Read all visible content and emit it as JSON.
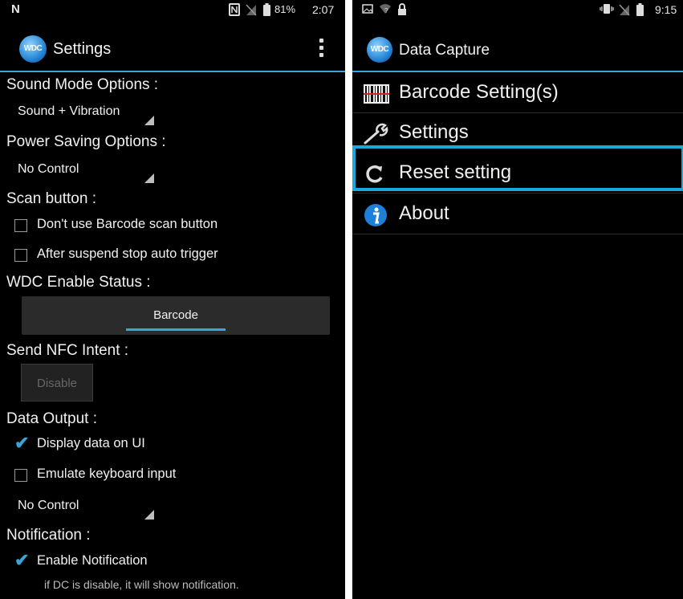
{
  "left_phone": {
    "status": {
      "battery_pct": "81%",
      "time": "2:07"
    },
    "title": "Settings",
    "logo_text": "WDC",
    "sections": {
      "sound_mode": "Sound Mode Options :",
      "power_saving": "Power Saving Options :",
      "scan_button": "Scan button :",
      "wdc_enable": "WDC Enable Status :",
      "send_nfc": "Send NFC Intent :",
      "data_output": "Data Output :",
      "notification": "Notification :"
    },
    "spinners": {
      "sound_mode": "Sound + Vibration",
      "power_saving": "No Control",
      "data_output": "No Control"
    },
    "checkboxes": [
      {
        "label": "Don't use Barcode scan button",
        "checked": false
      },
      {
        "label": "After suspend stop auto trigger",
        "checked": false
      },
      {
        "label": "Display data on UI",
        "checked": true
      },
      {
        "label": "Emulate keyboard input",
        "checked": false
      },
      {
        "label": "Enable Notification",
        "checked": true
      }
    ],
    "wdc_tab": "Barcode",
    "nfc_button": "Disable",
    "notification_hint": "if DC is disable, it will show notification."
  },
  "right_phone": {
    "status": {
      "time": "9:15"
    },
    "title": "Data Capture",
    "logo_text": "WDC",
    "menu": [
      {
        "label": "Barcode Setting(s)",
        "icon": "barcode-icon"
      },
      {
        "label": "Settings",
        "icon": "wrench-icon"
      },
      {
        "label": "Reset setting",
        "icon": "reset-icon",
        "highlighted": true
      },
      {
        "label": "About",
        "icon": "info-icon"
      }
    ]
  },
  "colors": {
    "accent": "#35a6d6",
    "highlight": "#1aa8dc",
    "background": "#000000"
  }
}
